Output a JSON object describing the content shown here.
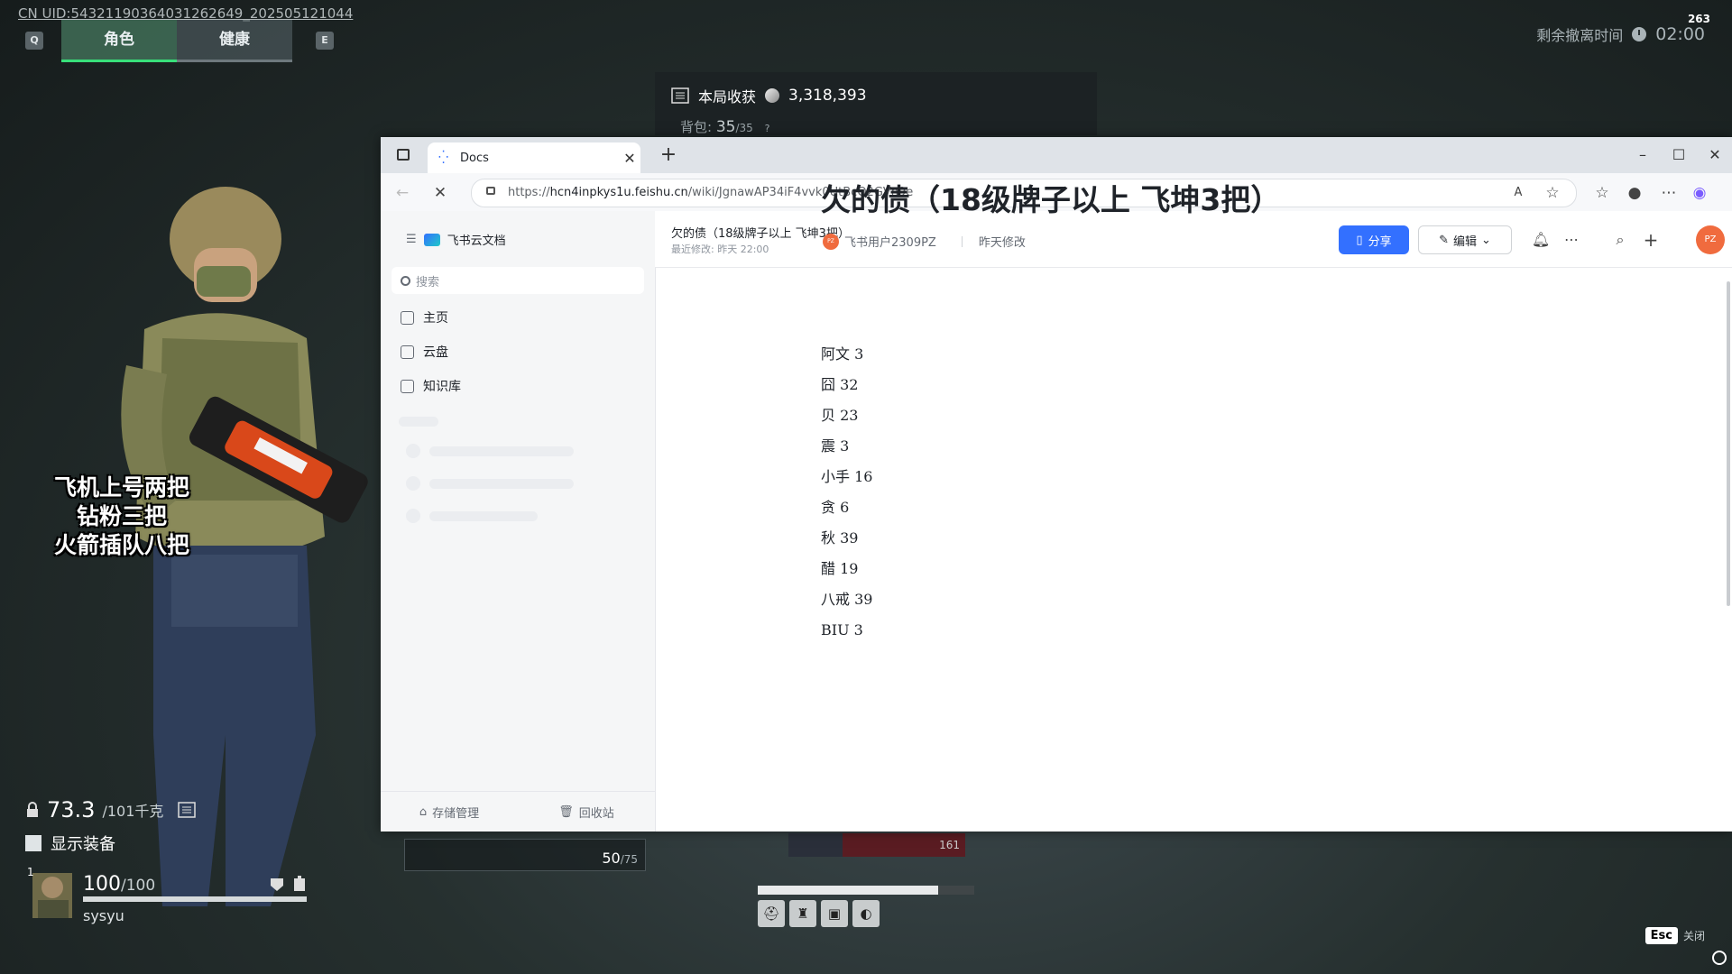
{
  "game": {
    "uid_prefix": "CN UID:",
    "uid": "543211903640312626​49_202505121044",
    "key_left": "Q",
    "key_right": "E",
    "tabs": [
      {
        "label": "角色",
        "active": true
      },
      {
        "label": "健康",
        "active": false
      }
    ],
    "extract_label": "剩余撤离时间",
    "extract_time": "02:00",
    "fps": "263",
    "loot_label": "本局收获",
    "loot_value": "3,318,393",
    "backpack_label": "背包:",
    "backpack_value": "35",
    "backpack_max": "/35",
    "backpack_q": "?",
    "overlay_lines": [
      "飞机上号两把",
      "钻粉三把",
      "火箭插队八把"
    ],
    "weight_value": "73.3",
    "weight_max": "/101千克",
    "show_equipment": "显示装备",
    "player_level": "1",
    "hp_value": "100",
    "hp_max": "/100",
    "player_name": "sysyu",
    "ammo_value": "50",
    "ammo_max": "/75",
    "item_value": "161",
    "esc_key": "Esc",
    "esc_label": "关闭"
  },
  "browser": {
    "tab_title": "Docs",
    "url_host": "hcn4inpkys1u.feishu.cn",
    "url_prefix": "https://",
    "url_path": "/wiki/JgnawAP34iF4vvk0UtBcQ2GVn9e"
  },
  "sidebar": {
    "brand": "飞书云文档",
    "search_placeholder": "搜索",
    "nav": [
      {
        "label": "主页",
        "icon": "home-icon"
      },
      {
        "label": "云盘",
        "icon": "cloud-drive-icon"
      },
      {
        "label": "知识库",
        "icon": "wiki-icon"
      }
    ],
    "footer": [
      {
        "label": "存储管理",
        "icon": "storage-icon"
      },
      {
        "label": "回收站",
        "icon": "trash-icon"
      }
    ]
  },
  "doc": {
    "header_title": "欠的债（18级牌子以上 飞坤3把）",
    "header_sub": "最近修改: 昨天 22:00",
    "share_label": "分享",
    "edit_label": "编辑",
    "avatar": "PZ",
    "title": "欠的债（18级牌子以上 飞坤3把）",
    "author_avatar": "PZ",
    "author": "飞书用户2309PZ",
    "modified": "昨天修改",
    "lines": [
      "阿文 3",
      "囧 32",
      "贝 23",
      "震 3",
      "小手 16",
      "贪 6",
      "秋 39",
      "醋 19",
      "八戒 39",
      "BIU 3"
    ]
  },
  "colors": {
    "accent": "#3370ff",
    "game_tab_active": "#38e07a",
    "avatar": "#f06b3e"
  }
}
